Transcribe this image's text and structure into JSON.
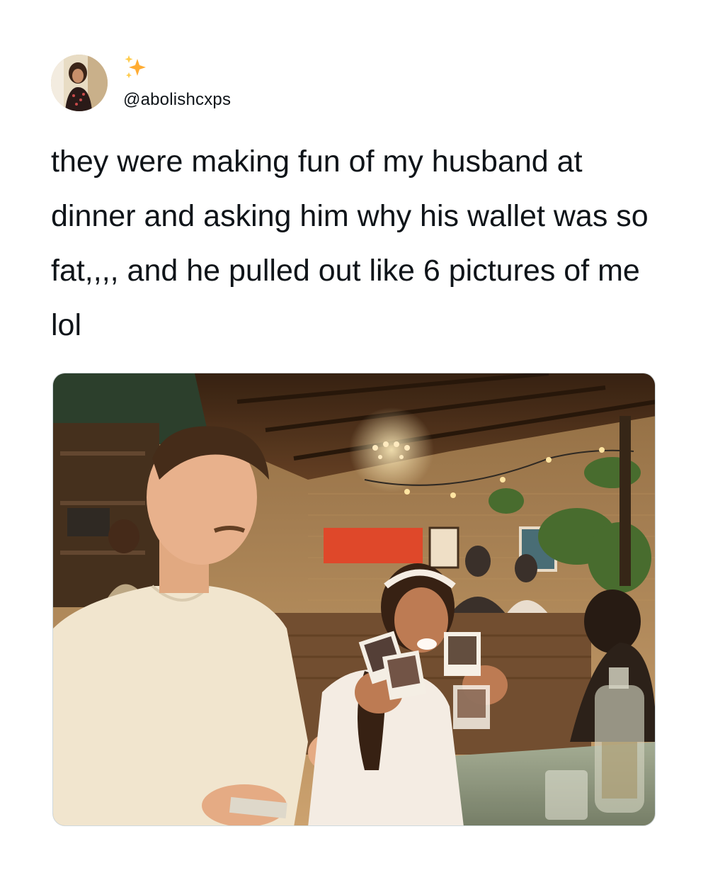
{
  "tweet": {
    "author": {
      "handle": "@abolishcxps",
      "avatar_icon": "profile-avatar",
      "name_emoji": "sparkles-icon"
    },
    "text": "they were making fun of my husband at dinner and asking him why his wallet was so fat,,,, and he pulled out like 6 pictures of me lol",
    "media": {
      "type": "photo",
      "icon": "photo-restaurant-scene"
    }
  },
  "colors": {
    "text": "#0f1419",
    "sparkle": "#ffac33",
    "background": "#ffffff",
    "border": "#cfd9de"
  }
}
